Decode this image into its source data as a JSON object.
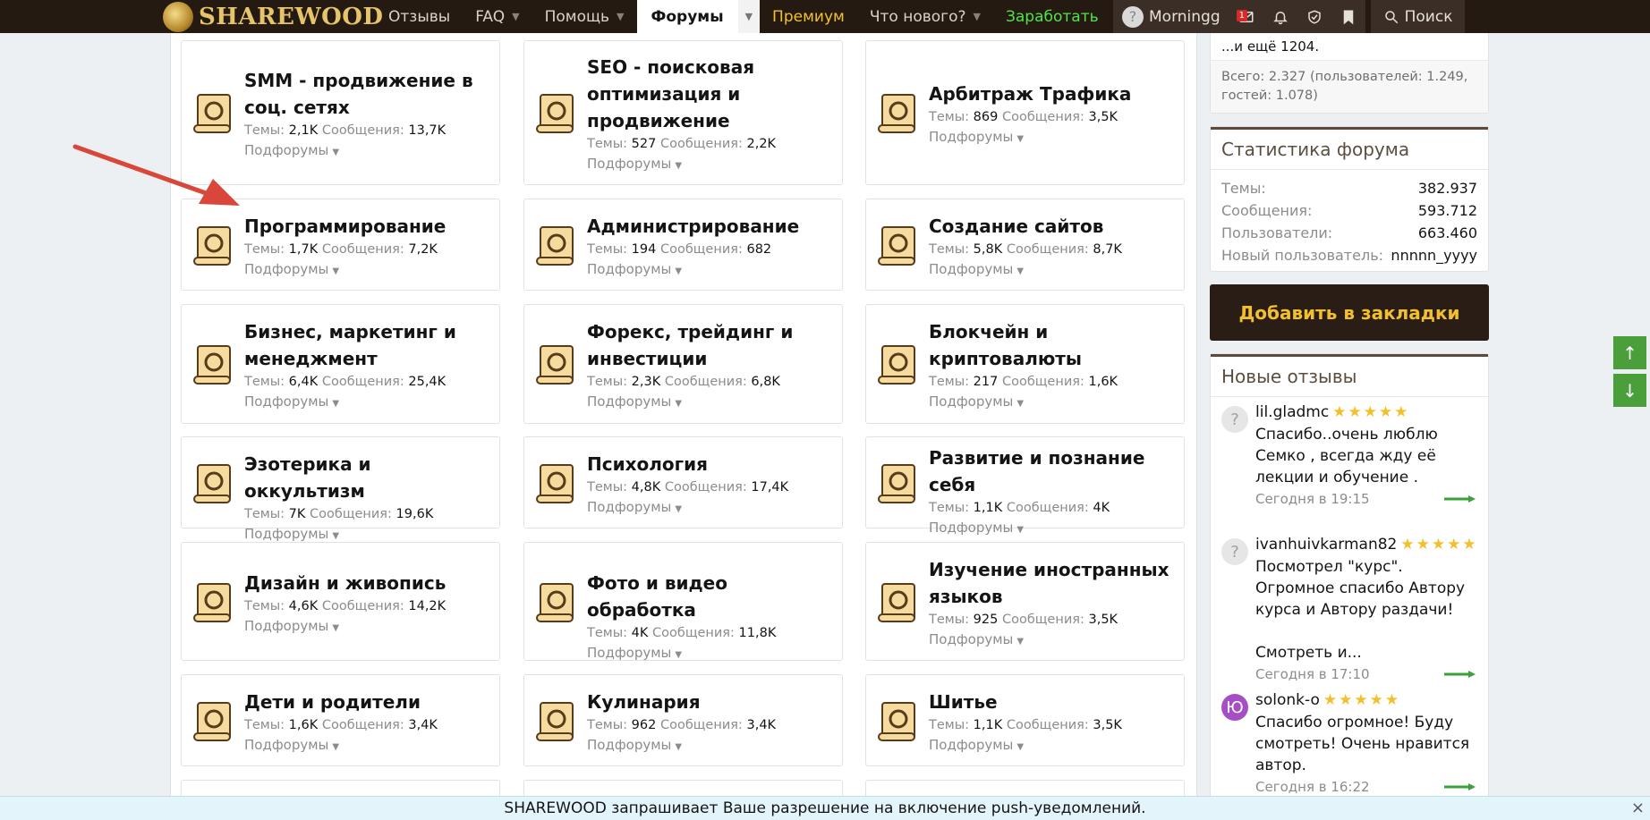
{
  "header": {
    "logo": "SHAREWOOD",
    "nav": [
      {
        "label": "Отзывы",
        "caret": false
      },
      {
        "label": "FAQ",
        "caret": true
      },
      {
        "label": "Помощь",
        "caret": true
      },
      {
        "label": "Форумы",
        "caret": true,
        "active": true
      },
      {
        "label": "Премиум",
        "caret": false
      },
      {
        "label": "Что нового?",
        "caret": true
      },
      {
        "label": "Заработать",
        "caret": false
      }
    ],
    "username": "Morningg",
    "inbox_badge": "1",
    "search_label": "Поиск"
  },
  "forums": [
    {
      "title": "SMM - продвижение в соц. сетях",
      "topics": "2,1K",
      "posts": "13,7K",
      "icon": "megaphone-icon"
    },
    {
      "title": "SEO - поисковая оптимизация и продвижение",
      "topics": "527",
      "posts": "2,2K",
      "icon": "magnifier-icon"
    },
    {
      "title": "Арбитраж Трафика",
      "topics": "869",
      "posts": "3,5K",
      "icon": "target-icon"
    },
    {
      "title": "Программирование",
      "topics": "1,7K",
      "posts": "7,2K",
      "icon": "laptop-icon"
    },
    {
      "title": "Администрирование",
      "topics": "194",
      "posts": "682",
      "icon": "gear-icon"
    },
    {
      "title": "Создание сайтов",
      "topics": "5,8K",
      "posts": "8,7K",
      "icon": "globe-icon"
    },
    {
      "title": "Бизнес, маркетинг и менеджмент",
      "topics": "6,4K",
      "posts": "25,4K",
      "icon": "moneybag-icon"
    },
    {
      "title": "Форекс, трейдинг и инвестиции",
      "topics": "2,3K",
      "posts": "6,8K",
      "icon": "chart-icon"
    },
    {
      "title": "Блокчейн и криптовалюты",
      "topics": "217",
      "posts": "1,6K",
      "icon": "bitcoin-icon"
    },
    {
      "title": "Эзотерика и оккультизм",
      "topics": "7K",
      "posts": "19,6K",
      "icon": "eye-pyramid-icon"
    },
    {
      "title": "Психология",
      "topics": "4,8K",
      "posts": "17,4K",
      "icon": "head-icon"
    },
    {
      "title": "Развитие и познание себя",
      "topics": "1,1K",
      "posts": "4K",
      "icon": "brain-icon"
    },
    {
      "title": "Дизайн и живопись",
      "topics": "4,6K",
      "posts": "14,2K",
      "icon": "brush-icon"
    },
    {
      "title": "Фото и видео обработка",
      "topics": "4K",
      "posts": "11,8K",
      "icon": "camera-icon"
    },
    {
      "title": "Изучение иностранных языков",
      "topics": "925",
      "posts": "3,5K",
      "icon": "hi-bubble-icon"
    },
    {
      "title": "Дети и родители",
      "topics": "1,6K",
      "posts": "3,4K",
      "icon": "rocking-horse-icon"
    },
    {
      "title": "Кулинария",
      "topics": "962",
      "posts": "3,4K",
      "icon": "chef-icon"
    },
    {
      "title": "Шитье",
      "topics": "1,1K",
      "posts": "3,5K",
      "icon": "sewing-machine-icon"
    }
  ],
  "labels": {
    "topics": "Темы:",
    "posts": "Сообщения:",
    "subforums": "Подфорумы"
  },
  "online": {
    "more": "...и ещё 1204.",
    "total": "Всего: 2.327 (пользователей: 1.249, гостей: 1.078)"
  },
  "stats": {
    "title": "Статистика форума",
    "rows": [
      {
        "k": "Темы:",
        "v": "382.937"
      },
      {
        "k": "Сообщения:",
        "v": "593.712"
      },
      {
        "k": "Пользователи:",
        "v": "663.460"
      },
      {
        "k": "Новый пользователь:",
        "v": "nnnnn_yyyy"
      }
    ]
  },
  "bookmark_button": "Добавить в закладки",
  "reviews": {
    "title": "Новые отзывы",
    "items": [
      {
        "name": "lil.gladmc",
        "avatar": "?",
        "text": "Спасибо..очень люблю Семко , всегда жду её лекции и обучение .",
        "date": "Сегодня в 19:15",
        "stars": "★★★★★"
      },
      {
        "name": "ivanhuivkarman82",
        "avatar": "?",
        "text": "Посмотрел \"курс\". Огромное спасибо Автору курса и Автору раздачи!",
        "more": "Смотреть и...",
        "date": "Сегодня в 17:10",
        "stars": "★★★★★"
      },
      {
        "name": "solonk-o",
        "avatar": "Ю",
        "text": "Спасибо огромное! Буду смотреть! Очень нравится автор.",
        "date": "Сегодня в 16:22",
        "stars": "★★★★★"
      }
    ]
  },
  "push_notice": "SHAREWOOD запрашивает Ваше разрешение на включение push-уведомлений."
}
